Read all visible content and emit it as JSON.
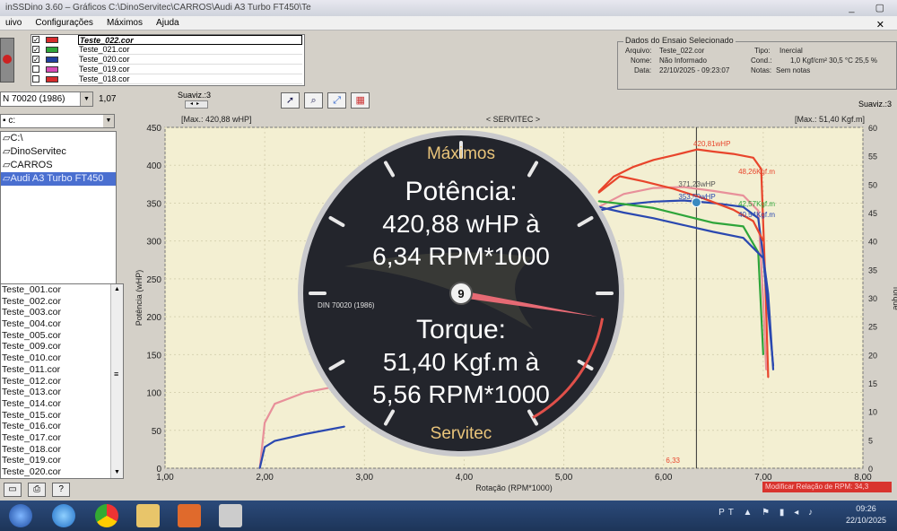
{
  "window": {
    "title": "inSSDino 3.60 – Gráficos C:\\DinoServitec\\CARROS\\Audi A3 Turbo FT450\\Te",
    "menu": [
      "uivo",
      "Configurações",
      "Máximos",
      "Ajuda"
    ]
  },
  "tests_selected": [
    {
      "name": "Teste_022.cor",
      "checked": "✓",
      "color": "#d62b2b",
      "selected": true
    },
    {
      "name": "Teste_021.cor",
      "checked": "✓",
      "color": "#2ea53a",
      "selected": false
    },
    {
      "name": "Teste_020.cor",
      "checked": "✓",
      "color": "#1f3f9e",
      "selected": false
    },
    {
      "name": "Teste_019.cor",
      "checked": "",
      "color": "#d64bb4",
      "selected": false
    },
    {
      "name": "Teste_018.cor",
      "checked": "",
      "color": "#d62b2b",
      "selected": false
    }
  ],
  "info": {
    "title": "Dados do Ensaio Selecionado",
    "arquivo_label": "Arquivo:",
    "arquivo": "Teste_022.cor",
    "tipo_label": "Tipo:",
    "tipo": "Inercial",
    "nome_label": "Nome:",
    "nome": "Não Informado",
    "cond_label": "Cond.:",
    "cond": "1,0 Kgf/cm²  30,5 °C   25,5 %",
    "data_label": "Data:",
    "data": "22/10/2025 - 09:23:07",
    "notas_label": "Notas:",
    "notas": "Sem notas"
  },
  "toolbar": {
    "norm": "N 70020 (1986)",
    "norm_factor": "1,07",
    "suaviz1": "Suaviz.:3",
    "suaviz2": "Suaviz.:3",
    "tools": [
      "pointer-tool",
      "zoom-tool",
      "fit-tool",
      "grid-tool"
    ]
  },
  "tree": {
    "drive": "c:",
    "folders": [
      "C:\\",
      "DinoServitec",
      "CARROS",
      "Audi A3 Turbo FT450"
    ]
  },
  "files": [
    "Teste_001.cor",
    "Teste_002.cor",
    "Teste_003.cor",
    "Teste_004.cor",
    "Teste_005.cor",
    "Teste_009.cor",
    "Teste_010.cor",
    "Teste_011.cor",
    "Teste_012.cor",
    "Teste_013.cor",
    "Teste_014.cor",
    "Teste_015.cor",
    "Teste_016.cor",
    "Teste_017.cor",
    "Teste_018.cor",
    "Teste_019.cor",
    "Teste_020.cor"
  ],
  "chart_header": {
    "max_power": "[Max.: 420,88 wHP]",
    "brand": "< SERVITEC >",
    "max_torque": "[Max.: 51,40 Kgf.m]"
  },
  "chart_data": {
    "type": "line",
    "xlabel": "Rotação (RPM*1000)",
    "ylabel": "Potência (wHP)",
    "y2label": "Torque",
    "xlim": [
      1.0,
      8.0
    ],
    "ylim": [
      0,
      450
    ],
    "y2lim": [
      0,
      60
    ],
    "xticks": [
      "1,00",
      "2,00",
      "3,00",
      "4,00",
      "5,00",
      "6,00",
      "7,00",
      "8,00"
    ],
    "yticks": [
      "0",
      "50",
      "100",
      "150",
      "200",
      "250",
      "300",
      "350",
      "400",
      "450"
    ],
    "y2ticks": [
      "0",
      "5",
      "10",
      "15",
      "20",
      "25",
      "30",
      "35",
      "40",
      "45",
      "50",
      "55",
      "60"
    ],
    "cursor_x": 6.33,
    "cursor_label": "6,33",
    "series": [
      {
        "name": "Teste_022.cor",
        "kind": "power",
        "color": "#e8452c",
        "x": [
          5.35,
          5.5,
          5.7,
          5.9,
          6.1,
          6.34,
          6.5,
          6.7,
          6.9,
          6.98,
          7.02,
          7.05
        ],
        "y": [
          365,
          385,
          398,
          407,
          413,
          420.88,
          418,
          415,
          410,
          395,
          250,
          120
        ]
      },
      {
        "name": "Teste_021.cor",
        "kind": "power",
        "color": "#e8909a",
        "x": [
          5.35,
          5.6,
          5.9,
          6.2,
          6.5,
          6.8,
          6.95,
          7.0,
          7.03
        ],
        "y": [
          345,
          362,
          370,
          371.23,
          366,
          360,
          340,
          220,
          130
        ]
      },
      {
        "name": "Teste_020.cor",
        "kind": "power",
        "color": "#2a48b0",
        "x": [
          5.35,
          5.6,
          5.9,
          6.2,
          6.5,
          6.8,
          6.95,
          7.05,
          7.1
        ],
        "y": [
          340,
          348,
          352,
          353.5,
          350,
          345,
          330,
          230,
          130
        ]
      },
      {
        "name": "Teste_022.cor",
        "kind": "torque",
        "color": "#e8452c",
        "x": [
          5.35,
          5.56,
          5.8,
          6.1,
          6.4,
          6.7,
          6.9,
          7.0
        ],
        "y": [
          48.5,
          51.4,
          50.5,
          49.2,
          47.5,
          45.5,
          43.5,
          40.0
        ]
      },
      {
        "name": "Teste_021.cor",
        "kind": "torque",
        "color": "#2ea53a",
        "x": [
          5.35,
          5.6,
          5.9,
          6.2,
          6.5,
          6.8,
          6.95,
          7.0
        ],
        "y": [
          47.0,
          46.5,
          45.8,
          44.5,
          43.2,
          42.57,
          38.0,
          20.0
        ]
      },
      {
        "name": "Teste_020.cor",
        "kind": "torque",
        "color": "#2a48b0",
        "x": [
          5.35,
          5.6,
          5.9,
          6.2,
          6.5,
          6.8,
          7.0,
          7.1
        ],
        "y": [
          46.0,
          45.0,
          44.0,
          42.8,
          41.6,
          40.54,
          37.0,
          18.0
        ]
      },
      {
        "name": "Teste_022.cor",
        "kind": "power",
        "color": "#e8909a",
        "x": [
          1.95,
          2.0,
          2.1,
          2.4,
          2.8
        ],
        "y": [
          0,
          60,
          85,
          100,
          110
        ]
      },
      {
        "name": "Teste_020.cor",
        "kind": "power",
        "color": "#2a48b0",
        "x": [
          1.95,
          2.0,
          2.1,
          2.4,
          2.8
        ],
        "y": [
          0,
          28,
          36,
          45,
          55
        ]
      }
    ],
    "labels": [
      {
        "text": "420,81wHP",
        "x": 6.3,
        "y": 425,
        "color": "#e8452c"
      },
      {
        "text": "371,23wHP",
        "x": 6.15,
        "y": 372,
        "color": "#555555"
      },
      {
        "text": "353,50wHP",
        "x": 6.15,
        "y": 355,
        "color": "#2a48b0"
      },
      {
        "text": "48,26Kgf.m",
        "x": 6.75,
        "y": 51.8,
        "color": "#e8452c",
        "axis": "y2"
      },
      {
        "text": "42,57Kgf.m",
        "x": 6.75,
        "y": 46.1,
        "color": "#2ea53a",
        "axis": "y2"
      },
      {
        "text": "40,54Kgf.m",
        "x": 6.75,
        "y": 44.2,
        "color": "#2a48b0",
        "axis": "y2"
      }
    ]
  },
  "gauge": {
    "title": "Máximos",
    "power_label": "Potência:",
    "power_value": "420,88 wHP  à",
    "power_rpm": "6,34 RPM*1000",
    "torque_label": "Torque:",
    "torque_value": "51,40 Kgf.m  à",
    "torque_rpm": "5,56 RPM*1000",
    "brand": "Servitec",
    "norm": "DIN 70020 (1986)",
    "hub": "9"
  },
  "modificar": "Modificar Relação de RPM: 34,3",
  "taskbar": {
    "lang": "PT",
    "time": "09:26",
    "date": "22/10/2025"
  }
}
